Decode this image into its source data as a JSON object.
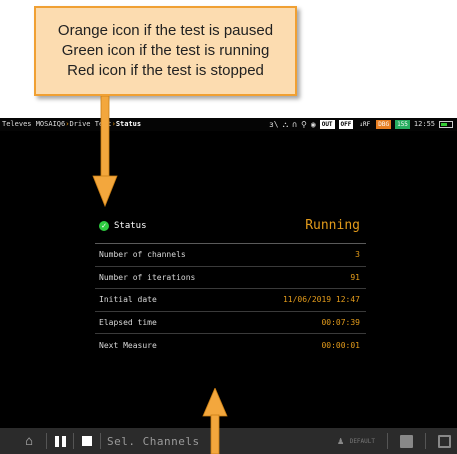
{
  "callout": {
    "line1": "Orange icon if the test is paused",
    "line2": "Green icon if the test is running",
    "line3": "Red icon if the test is stopped"
  },
  "statusbar": {
    "app": "Televes MOSAIQ6",
    "arrow": "›",
    "section": "Drive Test",
    "page": "Status",
    "out_label": "OUT",
    "off_label": "OFF",
    "rf_label": "↓RF",
    "dbg_label": "DBG",
    "num_label": "155",
    "time": "12:55"
  },
  "status": {
    "label": "Status",
    "value": "Running",
    "rows": [
      {
        "label": "Number of channels",
        "value": "3"
      },
      {
        "label": "Number of iterations",
        "value": "91"
      },
      {
        "label": "Initial date",
        "value": "11/06/2019 12:47"
      },
      {
        "label": "Elapsed time",
        "value": "00:07:39"
      },
      {
        "label": "Next Measure",
        "value": "00:00:01"
      }
    ]
  },
  "bottombar": {
    "sel_channels": "Sel. Channels",
    "default_label": "DEFAULT"
  },
  "colors": {
    "accent": "#e39b1b",
    "running": "#2ecc40",
    "callout_bg": "#fcdcb0",
    "callout_border": "#f0a033",
    "arrow": "#f3a73d"
  }
}
